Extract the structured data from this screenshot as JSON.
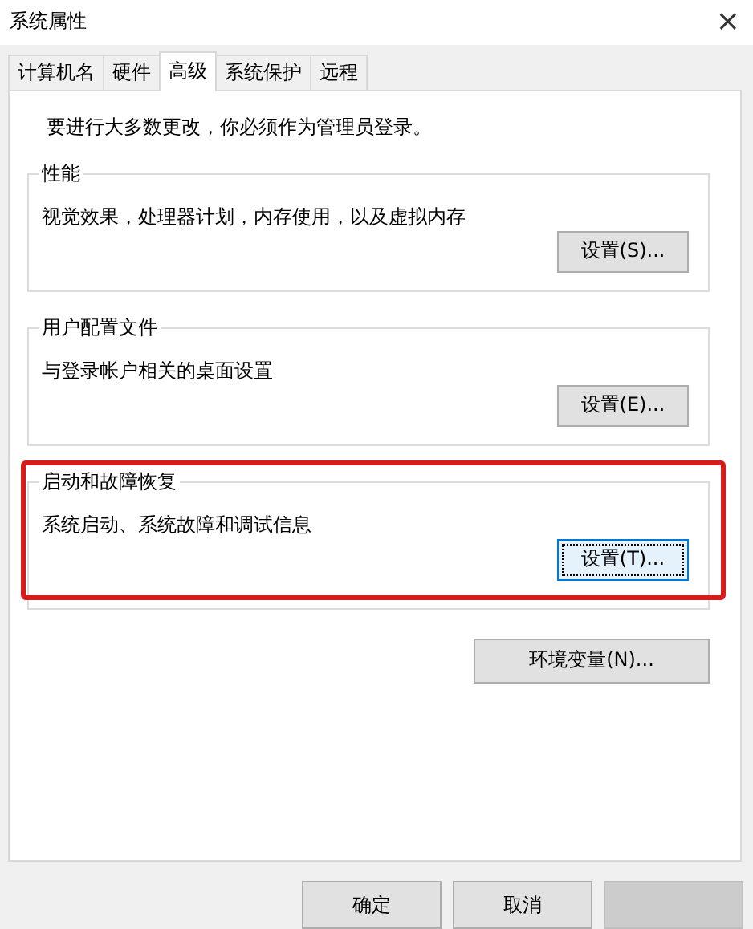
{
  "window": {
    "title": "系统属性",
    "close": "×"
  },
  "tabs": [
    {
      "label": "计算机名",
      "selected": false
    },
    {
      "label": "硬件",
      "selected": false
    },
    {
      "label": "高级",
      "selected": true
    },
    {
      "label": "系统保护",
      "selected": false
    },
    {
      "label": "远程",
      "selected": false
    }
  ],
  "notice": "要进行大多数更改，你必须作为管理员登录。",
  "groups": [
    {
      "title": "性能",
      "description": "视觉效果，处理器计划，内存使用，以及虚拟内存",
      "button": "设置(S)...",
      "focused": false,
      "highlighted": false
    },
    {
      "title": "用户配置文件",
      "description": "与登录帐户相关的桌面设置",
      "button": "设置(E)...",
      "focused": false,
      "highlighted": false
    },
    {
      "title": "启动和故障恢复",
      "description": "系统启动、系统故障和调试信息",
      "button": "设置(T)...",
      "focused": true,
      "highlighted": true
    }
  ],
  "env_button": "环境变量(N)...",
  "footer_buttons": [
    {
      "label": "确定",
      "disabled": false
    },
    {
      "label": "取消",
      "disabled": false
    },
    {
      "disabled": true
    }
  ]
}
